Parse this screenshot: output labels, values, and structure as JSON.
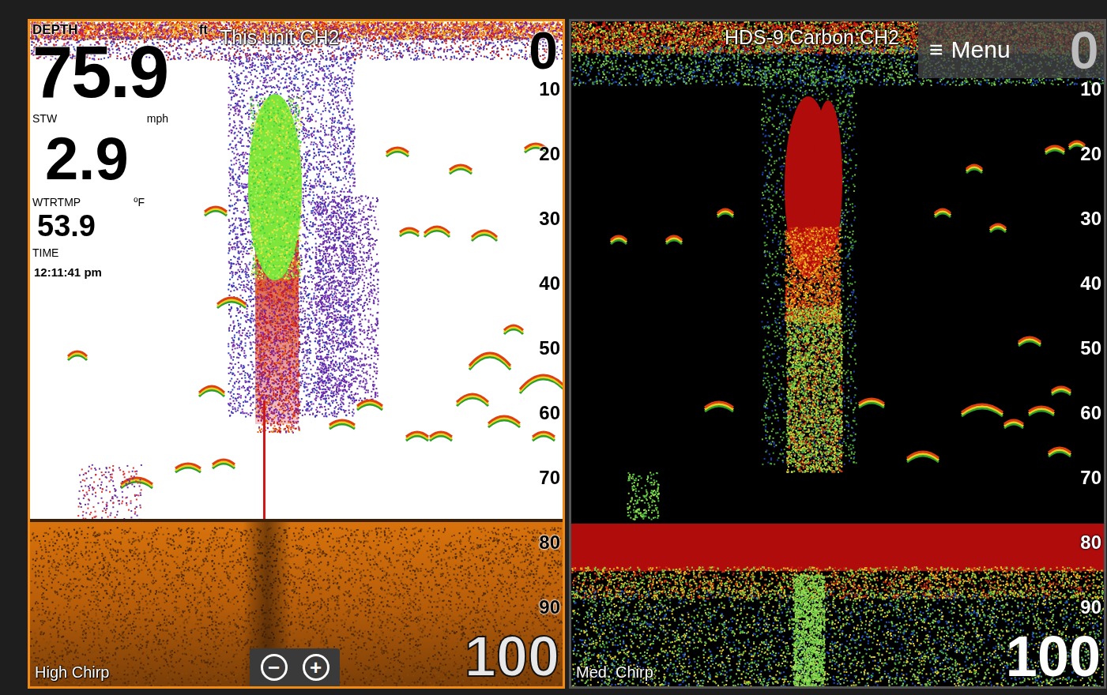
{
  "panels": [
    {
      "kind": "light",
      "selected": true,
      "source": "This unit CH2",
      "mode": "High Chirp",
      "range_top": "0",
      "range_bottom": "100",
      "scale": [
        "10",
        "20",
        "30",
        "40",
        "50",
        "60",
        "70",
        "80",
        "90"
      ],
      "readouts": [
        {
          "kind": "primary",
          "label": "DEPTH",
          "unit": "ft",
          "value": "75.9"
        },
        {
          "kind": "secondary",
          "label": "STW",
          "unit": "mph",
          "value": "2.9"
        },
        {
          "kind": "minor",
          "label": "WTRTMP",
          "unit": "ºF",
          "value": "53.9"
        },
        {
          "kind": "clock",
          "label": "TIME",
          "unit": "",
          "value": "12:11:41 pm"
        }
      ],
      "zoom": [
        "−",
        "+"
      ]
    },
    {
      "kind": "dark",
      "selected": false,
      "source": "HDS-9 Carbon:CH2",
      "mode": "Med. Chirp",
      "range_top": "0",
      "range_bottom": "100",
      "scale": [
        "10",
        "20",
        "30",
        "40",
        "50",
        "60",
        "70",
        "80",
        "90"
      ],
      "menu": {
        "icon": "≡",
        "label": "Menu"
      }
    }
  ]
}
